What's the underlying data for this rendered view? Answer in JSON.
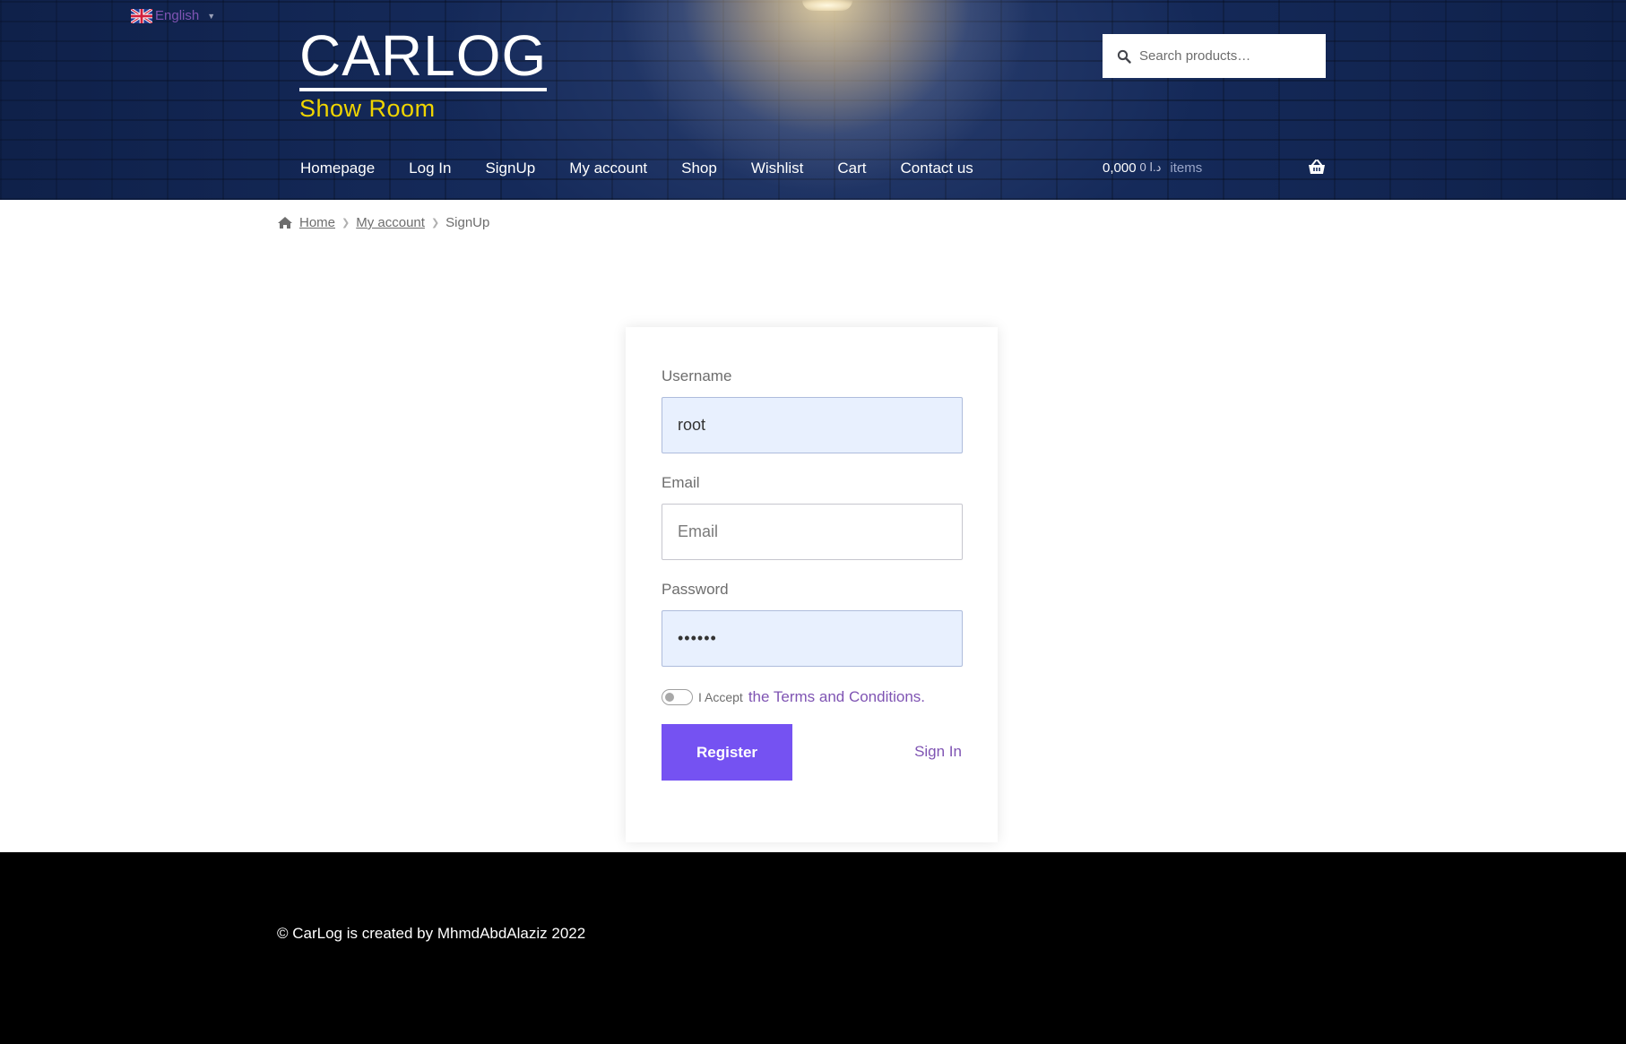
{
  "language": {
    "label": "English",
    "flag_icon": "uk-flag-icon"
  },
  "brand": {
    "title": "CARLOG",
    "tagline": "Show Room",
    "title_color": "#ffffff",
    "tagline_color": "#f0d500"
  },
  "search": {
    "placeholder": "Search products…",
    "icon": "search-icon"
  },
  "nav": {
    "items": [
      {
        "label": "Homepage"
      },
      {
        "label": "Log In"
      },
      {
        "label": "SignUp"
      },
      {
        "label": "My account"
      },
      {
        "label": "Shop"
      },
      {
        "label": "Wishlist"
      },
      {
        "label": "Cart"
      },
      {
        "label": "Contact us"
      }
    ]
  },
  "cart": {
    "amount": "0,000",
    "currency": "د.ا",
    "count": "0",
    "count_label": "items",
    "icon": "basket-icon"
  },
  "breadcrumb": {
    "home_icon": "home-icon",
    "items": [
      {
        "label": "Home"
      },
      {
        "label": "My account"
      },
      {
        "label": "SignUp"
      }
    ]
  },
  "form": {
    "username": {
      "label": "Username",
      "value": "root",
      "placeholder": "Username"
    },
    "email": {
      "label": "Email",
      "value": "",
      "placeholder": "Email"
    },
    "password": {
      "label": "Password",
      "value": "••••••"
    },
    "terms": {
      "prefix": "I Accept",
      "link": "the Terms and Conditions.",
      "checked": false
    },
    "register_label": "Register",
    "signin_label": "Sign In"
  },
  "footer": {
    "credit": "© CarLog is created by MhmdAbdAlaziz 2022"
  },
  "colors": {
    "accent": "#7552f2",
    "link": "#7f54b3",
    "header_bg": "#152a5a",
    "footer_bg": "#000000",
    "autofill_bg": "#e8f0fe"
  }
}
